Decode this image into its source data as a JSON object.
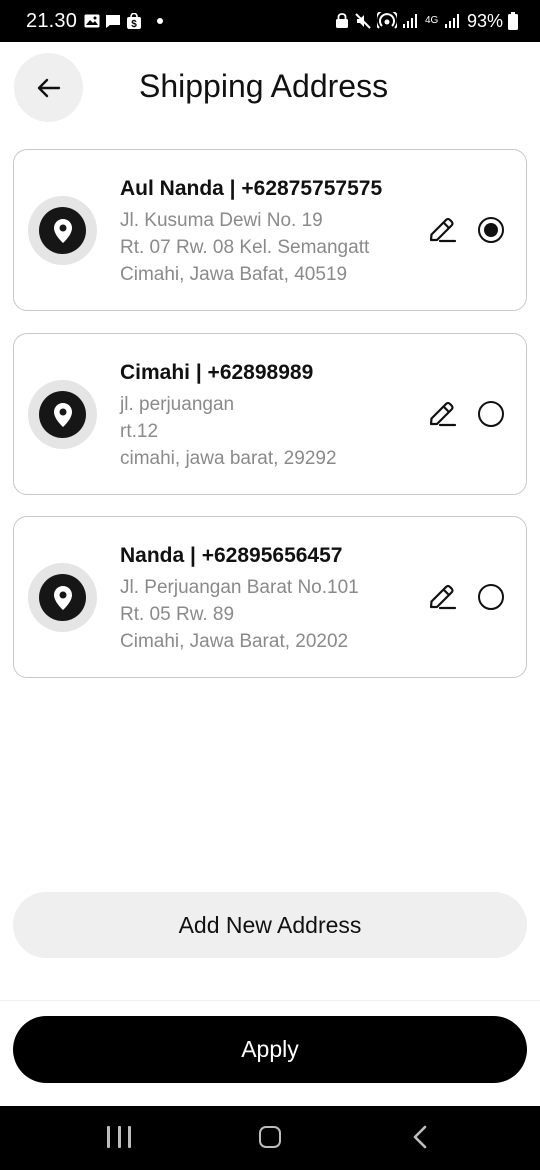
{
  "status_bar": {
    "time": "21.30",
    "battery": "93%",
    "network": "4G"
  },
  "header": {
    "title": "Shipping Address"
  },
  "addresses": [
    {
      "name": "Aul Nanda | +62875757575",
      "line1": "Jl. Kusuma Dewi No. 19",
      "line2": "Rt. 07 Rw. 08 Kel. Semangatt",
      "line3": "Cimahi, Jawa Bafat, 40519",
      "selected": true
    },
    {
      "name": "Cimahi | +62898989",
      "line1": "jl. perjuangan",
      "line2": "rt.12",
      "line3": "cimahi, jawa barat, 29292",
      "selected": false
    },
    {
      "name": "Nanda | +62895656457",
      "line1": "Jl. Perjuangan Barat No.101",
      "line2": "Rt. 05 Rw. 89",
      "line3": "Cimahi, Jawa Barat, 20202",
      "selected": false
    }
  ],
  "buttons": {
    "add_new": "Add New Address",
    "apply": "Apply"
  },
  "icons": {
    "back": "arrow-left-icon",
    "location": "location-pin-icon",
    "edit": "pencil-icon"
  },
  "colors": {
    "primary": "#000000",
    "secondary_button": "#efefef",
    "muted_text": "#8a8a8a"
  }
}
